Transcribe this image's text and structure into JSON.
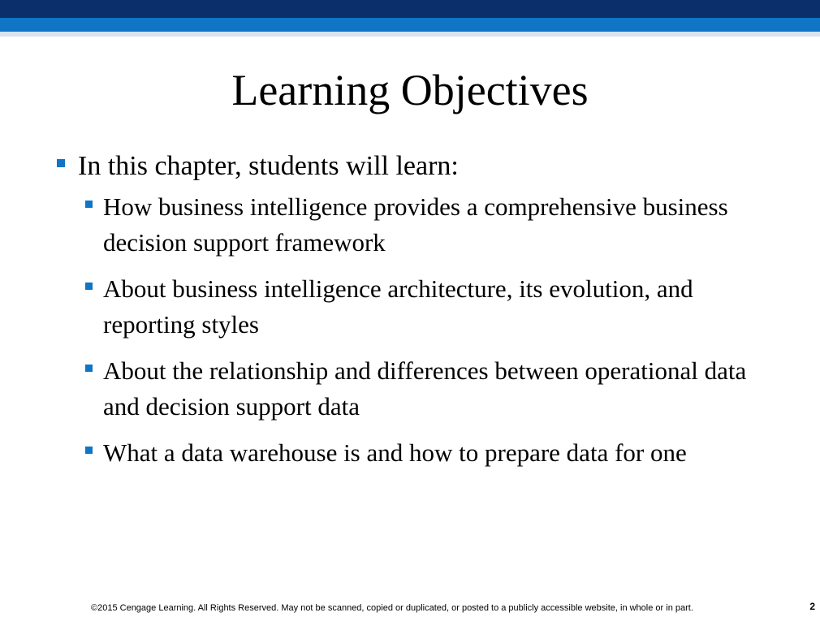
{
  "slide": {
    "title": "Learning Objectives",
    "intro": "In this chapter, students will learn:",
    "objectives": [
      "How business intelligence provides a comprehensive business decision support framework",
      "About business intelligence architecture, its evolution, and reporting styles",
      "About the relationship and differences between operational data and decision support data",
      "What a data warehouse is and how to prepare data for one"
    ],
    "footer": "©2015 Cengage Learning. All Rights Reserved. May not be scanned, copied or duplicated, or posted to a publicly accessible website, in whole or in part.",
    "page_number": "2"
  },
  "colors": {
    "header_dark": "#0b2f6b",
    "header_mid": "#0f75c4",
    "header_light": "#d7e4f3",
    "bullet": "#0f75c4"
  }
}
